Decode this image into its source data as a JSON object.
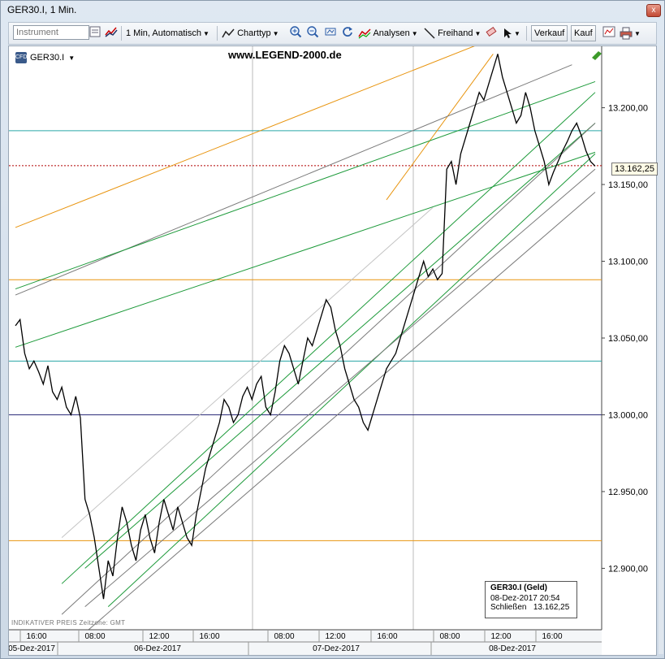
{
  "window": {
    "title": "GER30.I, 1 Min.",
    "close_glyph": "x"
  },
  "toolbar": {
    "instrument_placeholder": "Instrument",
    "timeframe": "1 Min,  Automatisch",
    "charttype": "Charttyp",
    "analysen": "Analysen",
    "freihand": "Freihand",
    "sell": "Verkauf",
    "buy": "Kauf"
  },
  "chart": {
    "watermark": "www.LEGEND-2000.de",
    "symbol": "GER30.I",
    "symbol_icon_text": "CFD",
    "last_price_label": "13.162,25",
    "disclaimer": "INDIKATIVER PREIS   Zeitzone: GMT",
    "info_box": {
      "header": "GER30.I (Geld)",
      "datetime": "08-Dez-2017 20:54",
      "close_label": "Schließen",
      "close_value": "13.162,25"
    },
    "time_ticks": [
      "16:00",
      "08:00",
      "12:00",
      "16:00",
      "08:00",
      "12:00",
      "16:00",
      "08:00",
      "12:00",
      "16:00"
    ],
    "date_labels": [
      "05-Dez-2017",
      "06-Dez-2017",
      "07-Dez-2017",
      "08-Dez-2017"
    ],
    "colors": {
      "price": "#000000",
      "orange": "#e8940e",
      "teal": "#2aa6a6",
      "navy": "#2d2d7a",
      "green": "#1d9a3a",
      "gray": "#7a7a7a",
      "lightgray": "#c4c4c4",
      "red": "#b00000"
    }
  },
  "chart_data": {
    "type": "line",
    "series": [
      {
        "values": [
          13058,
          13062,
          13040,
          13030,
          13035,
          13028,
          13020,
          13032,
          13015,
          13010,
          13018,
          13005,
          13000,
          13012,
          12998,
          12945,
          12935,
          12920,
          12900,
          12880,
          12905,
          12895,
          12920,
          12940,
          12930,
          12915,
          12905,
          12925,
          12935,
          12920,
          12910,
          12930,
          12945,
          12935,
          12925,
          12940,
          12930,
          12920,
          12915,
          12935,
          12950,
          12965,
          12975,
          12985,
          12995,
          13010,
          13005,
          12995,
          13000,
          13012,
          13018,
          13010,
          13020,
          13025,
          13005,
          13000,
          13015,
          13035,
          13045,
          13040,
          13030,
          13020,
          13035,
          13050,
          13045,
          13055,
          13065,
          13075,
          13070,
          13055,
          13045,
          13030,
          13020,
          13010,
          13005,
          12995,
          12990,
          13000,
          13010,
          13020,
          13030,
          13035,
          13040,
          13050,
          13060,
          13070,
          13080,
          13090,
          13100,
          13090,
          13095,
          13088,
          13092,
          13160,
          13165,
          13150,
          13170,
          13180,
          13190,
          13200,
          13210,
          13205,
          13215,
          13225,
          13235,
          13220,
          13210,
          13200,
          13190,
          13195,
          13210,
          13200,
          13185,
          13175,
          13165,
          13150,
          13158,
          13165,
          13172,
          13178,
          13185,
          13190,
          13182,
          13172,
          13165,
          13162
        ]
      }
    ],
    "ylim": [
      12860,
      13240
    ],
    "y_ticks": [
      "12.900,00",
      "12.950,00",
      "13.000,00",
      "13.050,00",
      "13.100,00",
      "13.150,00",
      "13.200,00"
    ],
    "y_tick_values": [
      12900,
      12950,
      13000,
      13050,
      13100,
      13150,
      13200
    ],
    "last_value": 13162.25,
    "horizontal_levels": [
      {
        "value": 13185,
        "color": "teal"
      },
      {
        "value": 13035,
        "color": "teal"
      },
      {
        "value": 13000,
        "color": "navy"
      },
      {
        "value": 13088,
        "color": "orange"
      },
      {
        "value": 12918,
        "color": "orange"
      },
      {
        "value": 13162.25,
        "color": "red"
      }
    ],
    "trend_lines": [
      {
        "color": "orange",
        "from": [
          0,
          13122
        ],
        "to": [
          103,
          13245
        ]
      },
      {
        "color": "orange",
        "from": [
          80,
          13140
        ],
        "to": [
          103,
          13235
        ]
      },
      {
        "color": "gray",
        "from": [
          0,
          13078
        ],
        "to": [
          120,
          13228
        ]
      },
      {
        "color": "green",
        "from": [
          0,
          13082
        ],
        "to": [
          125,
          13217
        ]
      },
      {
        "color": "green",
        "from": [
          0,
          13044
        ],
        "to": [
          125,
          13171
        ]
      },
      {
        "color": "green",
        "from": [
          10,
          12890
        ],
        "to": [
          125,
          13210
        ]
      },
      {
        "color": "green",
        "from": [
          15,
          12900
        ],
        "to": [
          125,
          13190
        ]
      },
      {
        "color": "green",
        "from": [
          20,
          12875
        ],
        "to": [
          125,
          13170
        ]
      },
      {
        "color": "gray",
        "from": [
          10,
          12870
        ],
        "to": [
          125,
          13190
        ]
      },
      {
        "color": "gray",
        "from": [
          15,
          12875
        ],
        "to": [
          125,
          13160
        ]
      },
      {
        "color": "gray",
        "from": [
          15,
          12858
        ],
        "to": [
          125,
          13145
        ]
      },
      {
        "color": "lightgray",
        "from": [
          10,
          12920
        ],
        "to": [
          90,
          13135
        ]
      }
    ]
  }
}
